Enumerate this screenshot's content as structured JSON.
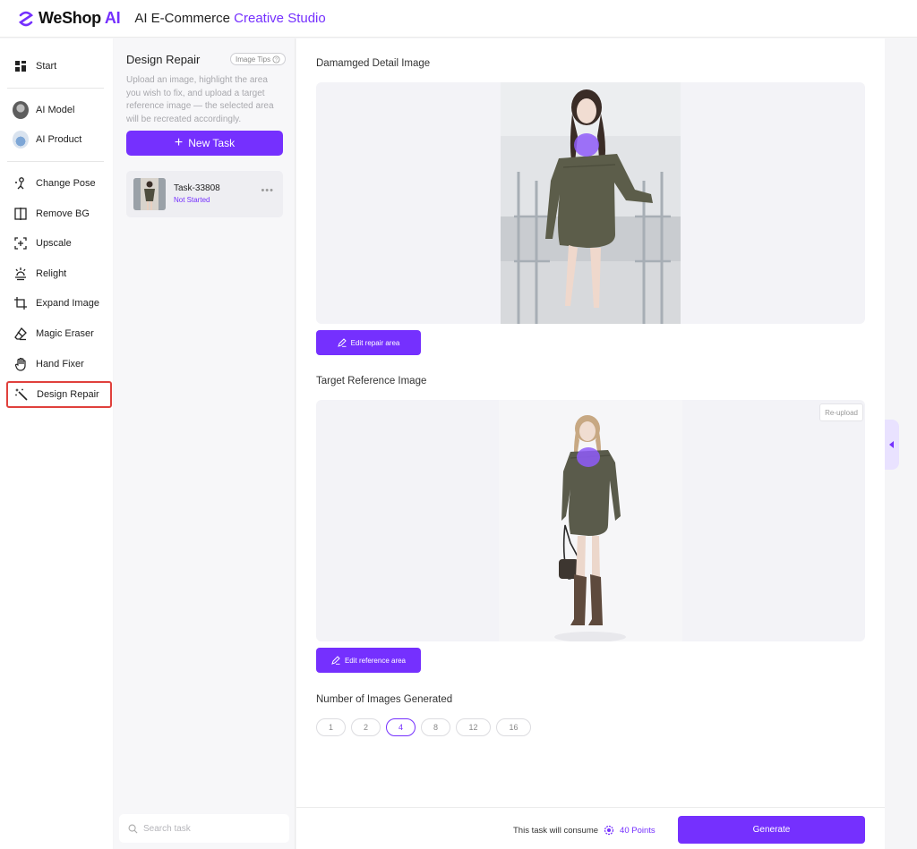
{
  "header": {
    "logo_main": "WeShop ",
    "logo_ai": "AI",
    "title_main": "AI E-Commerce ",
    "title_accent": "Creative Studio"
  },
  "nav": {
    "start": "Start",
    "ai_model": "AI Model",
    "ai_product": "AI Product",
    "change_pose": "Change Pose",
    "remove_bg": "Remove BG",
    "upscale": "Upscale",
    "relight": "Relight",
    "expand_image": "Expand Image",
    "magic_eraser": "Magic Eraser",
    "hand_fixer": "Hand Fixer",
    "design_repair": "Design Repair"
  },
  "task_panel": {
    "title": "Design Repair",
    "image_tips": "Image Tips",
    "description": "Upload an image, highlight the area you wish to fix, and upload a target reference image — the selected area will be recreated accordingly.",
    "new_task": "New Task",
    "task": {
      "name": "Task-33808",
      "status": "Not Started"
    },
    "search_placeholder": "Search task"
  },
  "main": {
    "damaged_label": "Damamged Detail Image",
    "edit_repair": "Edit repair area",
    "target_label": "Target Reference Image",
    "reupload": "Re-upload",
    "edit_reference": "Edit reference area",
    "num_label": "Number of Images Generated",
    "num_options": [
      "1",
      "2",
      "4",
      "8",
      "12",
      "16"
    ],
    "num_selected": "4",
    "consume_text": "This task will consume",
    "points": "40 Points",
    "generate": "Generate"
  },
  "colors": {
    "accent": "#7530fe",
    "highlight_border": "#e0403c"
  }
}
